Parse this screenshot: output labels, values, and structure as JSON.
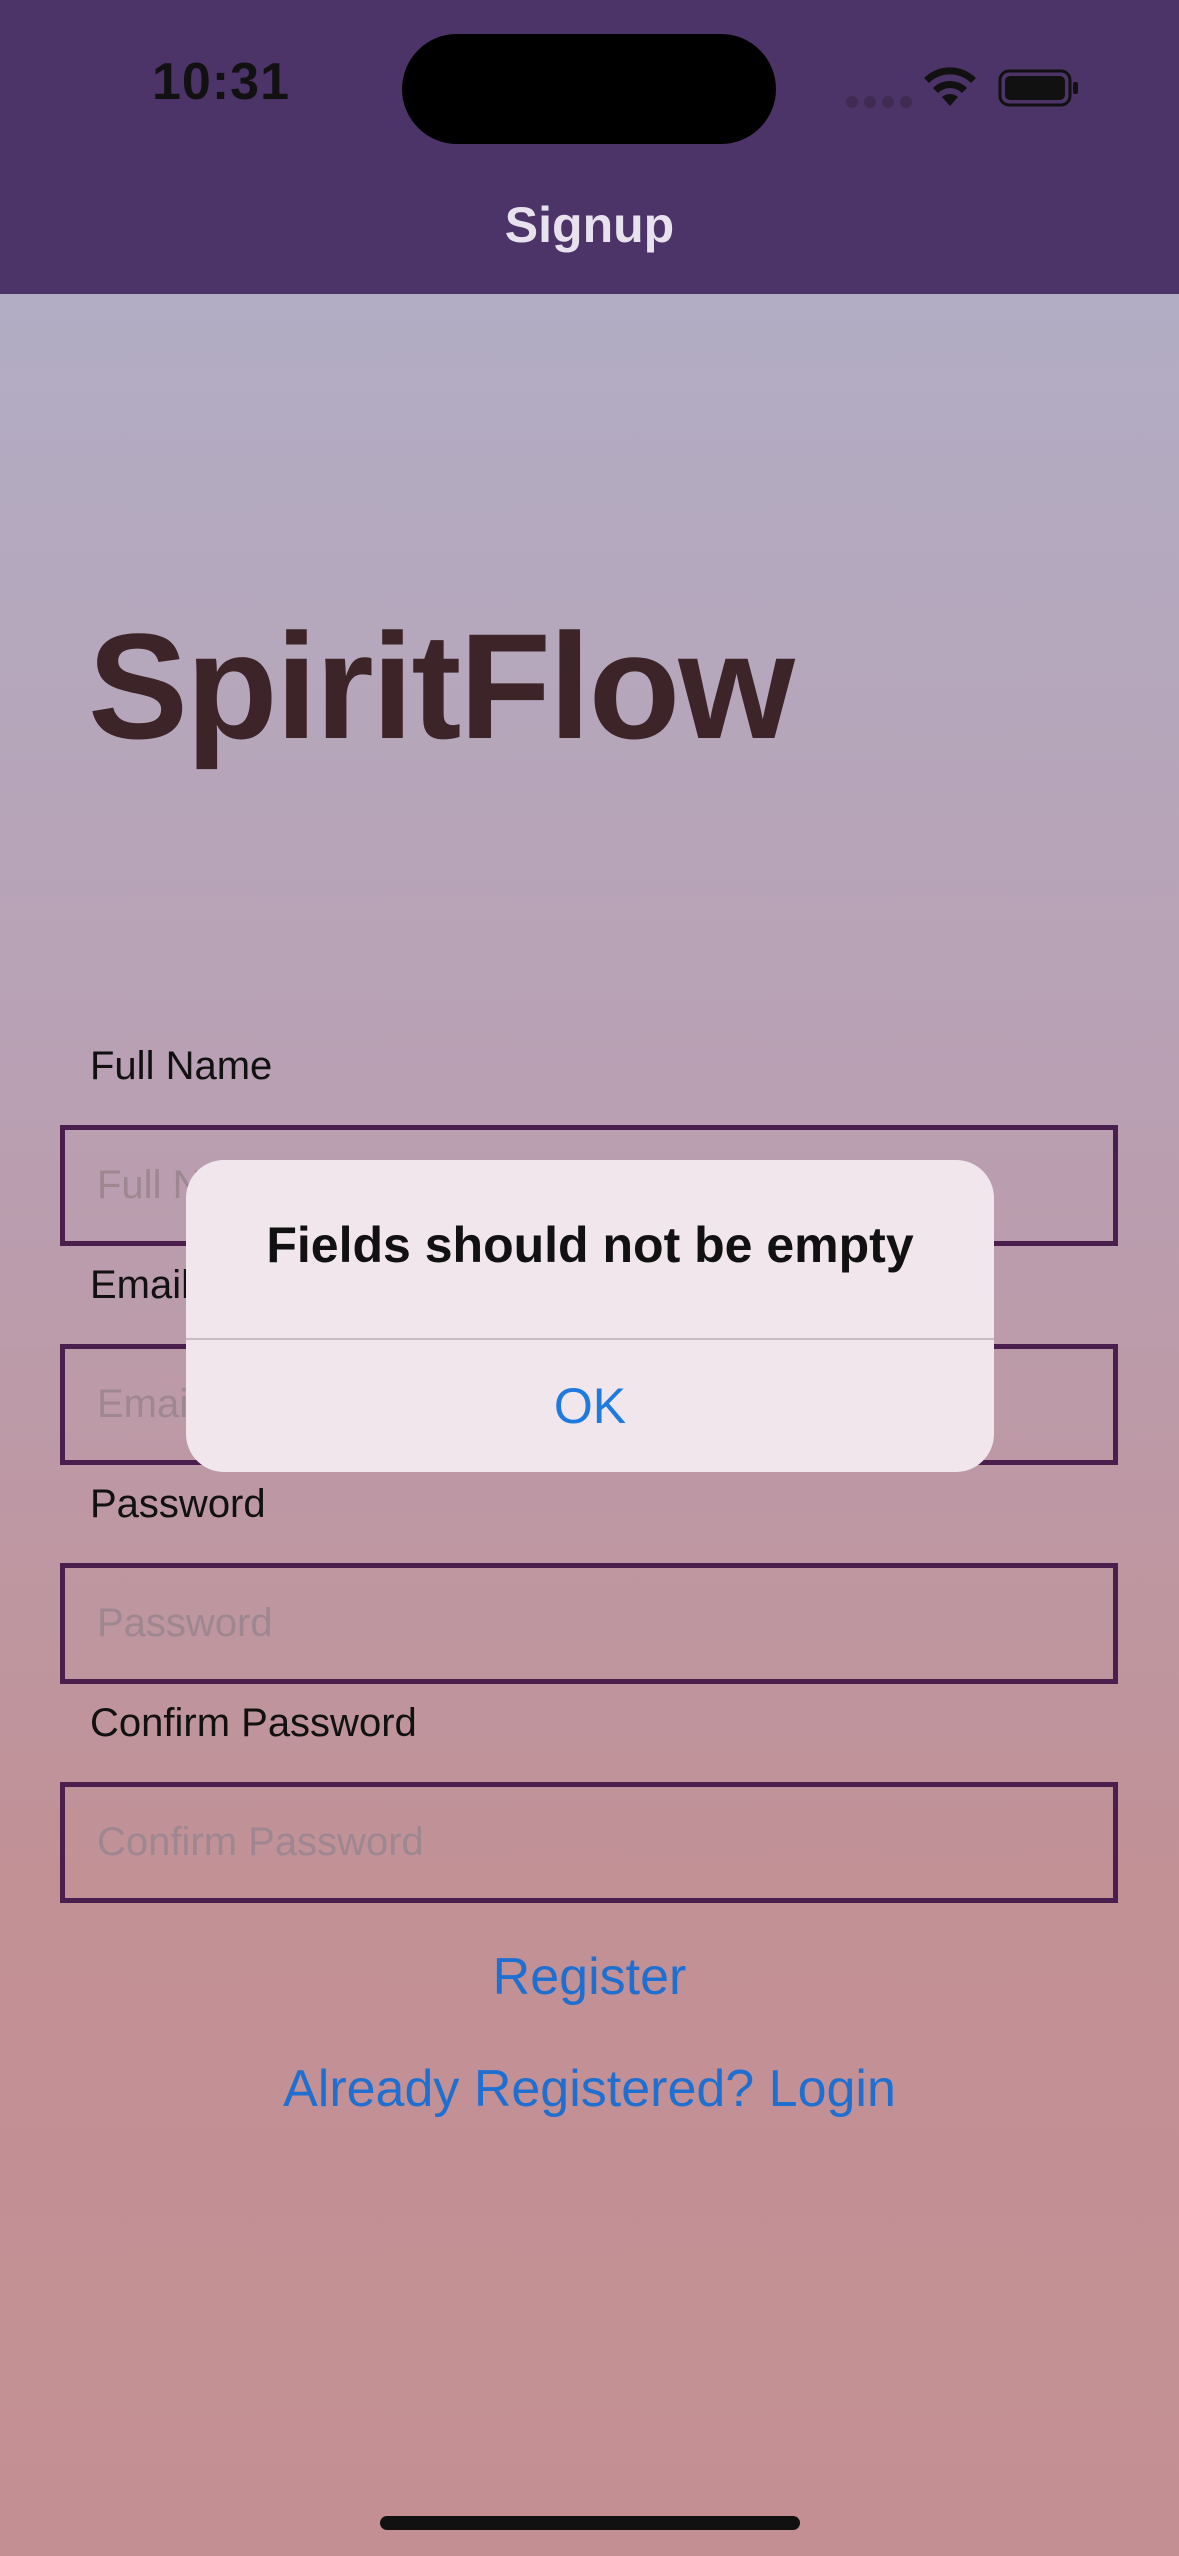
{
  "status_bar": {
    "time": "10:31"
  },
  "nav": {
    "title": "Signup"
  },
  "app": {
    "title": "SpiritFlow"
  },
  "form": {
    "full_name": {
      "label": "Full Name",
      "placeholder": "Full Name",
      "value": ""
    },
    "email": {
      "label": "Email",
      "placeholder": "Email",
      "value": ""
    },
    "password": {
      "label": "Password",
      "placeholder": "Password",
      "value": ""
    },
    "confirm_password": {
      "label": "Confirm Password",
      "placeholder": "Confirm Password",
      "value": ""
    }
  },
  "actions": {
    "register_label": "Register",
    "login_label": "Already Registered? Login"
  },
  "alert": {
    "title": "Fields should not be empty",
    "ok_label": "OK"
  },
  "colors": {
    "nav_bg": "#4d3468",
    "title_text": "#3d2428",
    "input_border": "#4a1f4e",
    "link": "#1f6fd0",
    "alert_button": "#1f7ae0"
  }
}
